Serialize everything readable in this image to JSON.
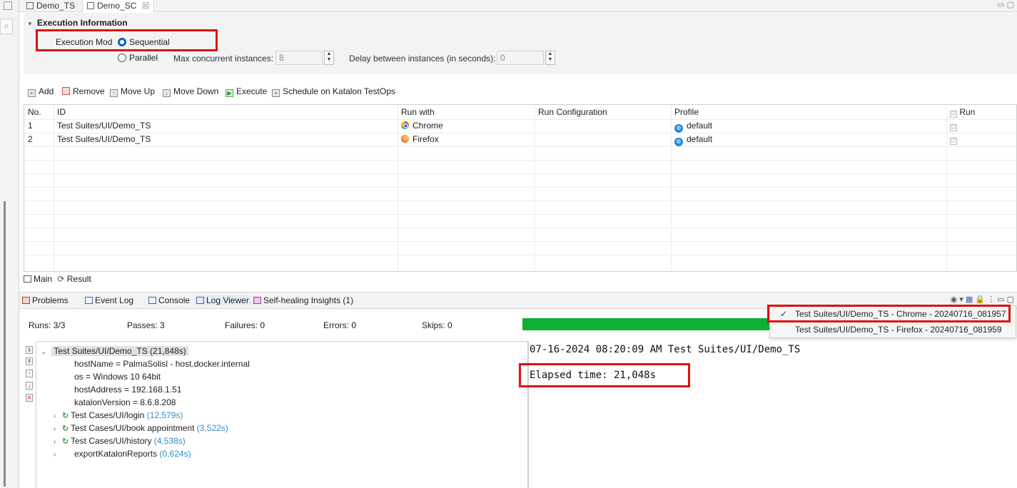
{
  "editor_tabs": [
    {
      "label": "Demo_TS",
      "active": false
    },
    {
      "label": "Demo_SC",
      "active": true
    }
  ],
  "execution": {
    "section_title": "Execution Information",
    "mode_label": "Execution Mod",
    "option_sequential": "Sequential",
    "option_parallel": "Parallel",
    "max_label": "Max concurrent instances:",
    "max_value": "8",
    "delay_label": "Delay between instances (in seconds):",
    "delay_value": "0"
  },
  "toolbar": {
    "add": "Add",
    "remove": "Remove",
    "move_up": "Move Up",
    "move_down": "Move Down",
    "execute": "Execute",
    "schedule": "Schedule on Katalon TestOps"
  },
  "table": {
    "headers": {
      "no": "No.",
      "id": "ID",
      "run_with": "Run with",
      "run_config": "Run Configuration",
      "profile": "Profile",
      "run": "Run"
    },
    "rows": [
      {
        "no": "1",
        "id": "Test Suites/UI/Demo_TS",
        "run_with": "Chrome",
        "run_config": "",
        "profile": "default"
      },
      {
        "no": "2",
        "id": "Test Suites/UI/Demo_TS",
        "run_with": "Firefox",
        "run_config": "",
        "profile": "default"
      }
    ]
  },
  "main_result_tabs": {
    "main": "Main",
    "result": "Result"
  },
  "console_tabs": {
    "problems": "Problems",
    "event_log": "Event Log",
    "console": "Console",
    "log_viewer": "Log Viewer",
    "self_healing": "Self-healing Insights (1)"
  },
  "stats": {
    "runs": "Runs: 3/3",
    "passes": "Passes: 3",
    "failures": "Failures: 0",
    "errors": "Errors: 0",
    "skips": "Skips: 0"
  },
  "progress_fraction": 1.0,
  "tree": {
    "root": {
      "label": "Test Suites/UI/Demo_TS (21,848s)"
    },
    "props": [
      "hostName = PalmaSolisl - host.docker.internal",
      "os = Windows 10 64bit",
      "hostAddress = 192.168.1.51",
      "katalonVersion = 8.6.8.208"
    ],
    "cases": [
      {
        "label": "Test Cases/UI/login",
        "duration": "(12,579s)",
        "passed": true
      },
      {
        "label": "Test Cases/UI/book appointment",
        "duration": "(3,522s)",
        "passed": true
      },
      {
        "label": "Test Cases/UI/history",
        "duration": "(4,538s)",
        "passed": true
      },
      {
        "label": "exportKatalonReports",
        "duration": "(0,624s)",
        "passed": false
      }
    ]
  },
  "log": {
    "line1": "07-16-2024 08:20:09 AM Test Suites/UI/Demo_TS",
    "line2": "Elapsed time: 21,048s"
  },
  "dropdown": {
    "items": [
      {
        "label": "Test Suites/UI/Demo_TS - Chrome - 20240716_081957",
        "checked": true
      },
      {
        "label": "Test Suites/UI/Demo_TS - Firefox - 20240716_081959",
        "checked": false
      }
    ]
  },
  "colors": {
    "accent": "#0a62c9",
    "progress": "#0fb034",
    "highlight": "#e01010",
    "duration": "#2f8dc3"
  }
}
